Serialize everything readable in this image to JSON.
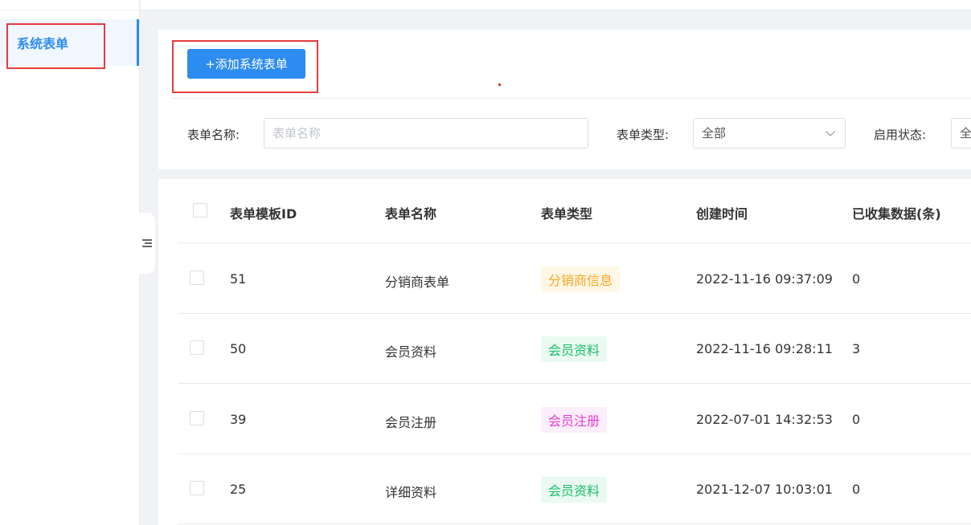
{
  "sidebar": {
    "items": [
      {
        "label": "系统表单"
      }
    ]
  },
  "toolbar": {
    "add_label": "+添加系统表单"
  },
  "filters": {
    "name_label": "表单名称:",
    "name_placeholder": "表单名称",
    "type_label": "表单类型:",
    "type_value": "全部",
    "status_label": "启用状态:",
    "status_value": "全"
  },
  "table": {
    "headers": [
      "表单模板ID",
      "表单名称",
      "表单类型",
      "创建时间",
      "已收集数据(条)"
    ],
    "rows": [
      {
        "id": "51",
        "name": "分销商表单",
        "type": "分销商信息",
        "created": "2022-11-16 09:37:09",
        "count": "0"
      },
      {
        "id": "50",
        "name": "会员资料",
        "type": "会员资料",
        "created": "2022-11-16 09:28:11",
        "count": "3"
      },
      {
        "id": "39",
        "name": "会员注册",
        "type": "会员注册",
        "created": "2022-07-01 14:32:53",
        "count": "0"
      },
      {
        "id": "25",
        "name": "详细资料",
        "type": "会员资料",
        "created": "2021-12-07 10:03:01",
        "count": "0"
      }
    ]
  },
  "colors": {
    "accent": "#2d8cf0",
    "highlight": "#e63c3c",
    "tag_orange_text": "#f5a623",
    "tag_orange_bg": "#fff7e6",
    "tag_green_text": "#19be6b",
    "tag_green_bg": "#eafaf1",
    "tag_pink_text": "#e23fd0",
    "tag_pink_bg": "#fdeefb"
  }
}
